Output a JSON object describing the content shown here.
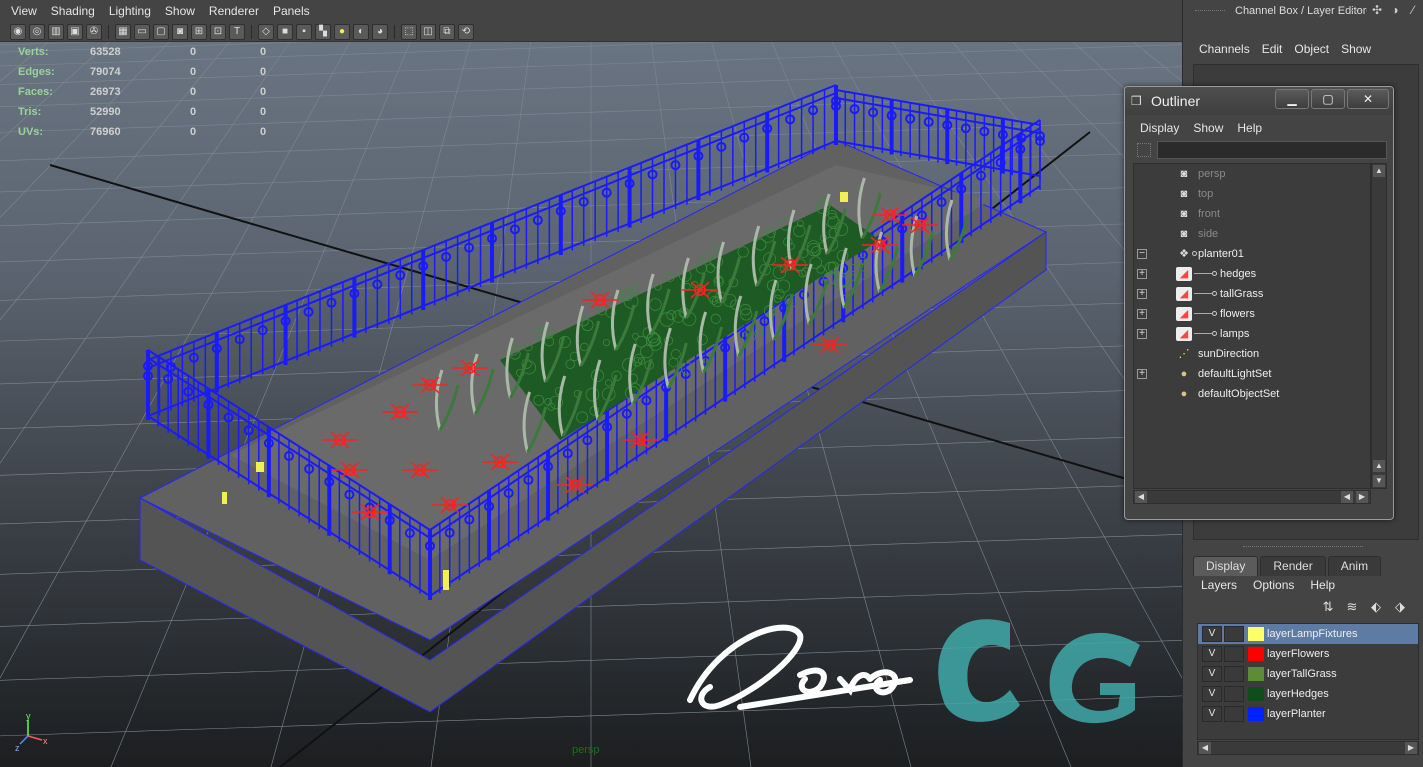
{
  "viewport": {
    "menus": [
      "View",
      "Shading",
      "Lighting",
      "Show",
      "Renderer",
      "Panels"
    ],
    "toolbar_icons": [
      "camera-select-icon",
      "camera-attributes-icon",
      "bookmark-icon",
      "image-plane-icon",
      "camera-lock-icon",
      "grid-icon",
      "film-gate-icon",
      "resolution-gate-icon",
      "gate-mask-icon",
      "field-chart-icon",
      "safe-action-icon",
      "safe-title-icon",
      "wireframe-icon",
      "smooth-shade-icon",
      "flat-shade-icon",
      "textured-icon",
      "use-all-lights-icon",
      "shadows-icon",
      "ambient-occlusion-icon",
      "isolate-select-icon",
      "xray-icon",
      "xray-joints-icon",
      "backface-icon"
    ],
    "hud": [
      {
        "label": "Verts:",
        "v1": "63528",
        "v2": "0",
        "v3": "0"
      },
      {
        "label": "Edges:",
        "v1": "79074",
        "v2": "0",
        "v3": "0"
      },
      {
        "label": "Faces:",
        "v1": "26973",
        "v2": "0",
        "v3": "0"
      },
      {
        "label": "Tris:",
        "v1": "52990",
        "v2": "0",
        "v3": "0"
      },
      {
        "label": "UVs:",
        "v1": "76960",
        "v2": "0",
        "v3": "0"
      }
    ],
    "camera_name": "persp",
    "axis_labels": {
      "y": "y",
      "x": "x",
      "z": "z"
    },
    "colors": {
      "fence": "#1a1aff",
      "flowers": "#ff2020",
      "grass": "#2f7a2f",
      "planter": "#5a5a5a",
      "hud_label": "#9bd39b"
    }
  },
  "channel_box": {
    "title": "Channel Box / Layer Editor",
    "menus": [
      "Channels",
      "Edit",
      "Object",
      "Show"
    ]
  },
  "layer_editor": {
    "tabs": [
      "Display",
      "Render",
      "Anim"
    ],
    "active_tab": "Display",
    "menus": [
      "Layers",
      "Options",
      "Help"
    ],
    "tool_icons": [
      "move-layer-up-icon",
      "create-layer-icon",
      "create-empty-layer-icon",
      "create-layer-from-selected-icon"
    ],
    "layers": [
      {
        "visible": "V",
        "name": "layerLampFixtures",
        "color": "#ffff66",
        "selected": true
      },
      {
        "visible": "V",
        "name": "layerFlowers",
        "color": "#ff0000",
        "selected": false
      },
      {
        "visible": "V",
        "name": "layerTallGrass",
        "color": "#5e8c35",
        "selected": false
      },
      {
        "visible": "V",
        "name": "layerHedges",
        "color": "#0f4d1a",
        "selected": false
      },
      {
        "visible": "V",
        "name": "layerPlanter",
        "color": "#0022ff",
        "selected": false
      }
    ]
  },
  "outliner": {
    "title": "Outliner",
    "menus": [
      "Display",
      "Show",
      "Help"
    ],
    "window_buttons": [
      "▁",
      "▢",
      "✕"
    ],
    "filter_value": "",
    "items": [
      {
        "name": "persp",
        "icon": "camera-icon",
        "level": 0,
        "dim": true,
        "expander": ""
      },
      {
        "name": "top",
        "icon": "camera-icon",
        "level": 0,
        "dim": true,
        "expander": ""
      },
      {
        "name": "front",
        "icon": "camera-icon",
        "level": 0,
        "dim": true,
        "expander": ""
      },
      {
        "name": "side",
        "icon": "camera-icon",
        "level": 0,
        "dim": true,
        "expander": ""
      },
      {
        "name": "planter01",
        "icon": "group-icon",
        "level": 0,
        "dim": false,
        "expander": "−"
      },
      {
        "name": "hedges",
        "icon": "mesh-icon",
        "level": 1,
        "dim": false,
        "expander": "+"
      },
      {
        "name": "tallGrass",
        "icon": "mesh-icon",
        "level": 1,
        "dim": false,
        "expander": "+"
      },
      {
        "name": "flowers",
        "icon": "mesh-icon",
        "level": 1,
        "dim": false,
        "expander": "+"
      },
      {
        "name": "lamps",
        "icon": "mesh-icon",
        "level": 1,
        "dim": false,
        "expander": "+"
      },
      {
        "name": "sunDirection",
        "icon": "directional-light-icon",
        "level": 0,
        "dim": false,
        "expander": ""
      },
      {
        "name": "defaultLightSet",
        "icon": "set-icon",
        "level": 0,
        "dim": false,
        "expander": "+"
      },
      {
        "name": "defaultObjectSet",
        "icon": "set-icon",
        "level": 0,
        "dim": false,
        "expander": ""
      }
    ]
  }
}
